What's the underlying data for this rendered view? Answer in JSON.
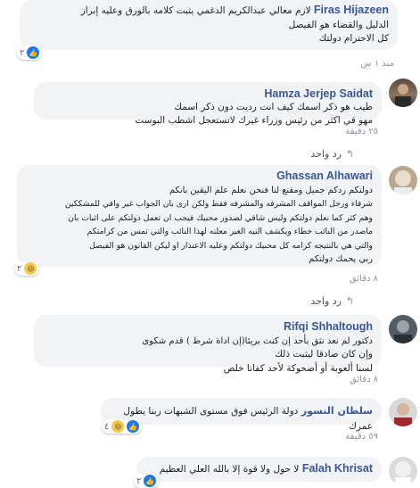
{
  "comments": [
    {
      "author": "Firas Hijazeen",
      "lines": [
        "لازم معالي عبدالكريم الدغمي يثبت كلامه بالورق وعليه إبراز",
        "الدليل والقضاء هو الفيصل",
        "كل الاحترام دولتك"
      ],
      "reaction_count": "٢",
      "time": "منذ ١ س"
    },
    {
      "author": "Hamza Jerjep Saidat",
      "lines": [
        "طيب هو ذكر اسمك كيف انت رديت دون ذكر اسمك",
        "مهو في اكثر من رئيس وزراء غيرك لاتستعجل اشطب البوست"
      ],
      "time": "٢٥ دقيقة",
      "reply_label": "رد واحد"
    },
    {
      "author": "Ghassan Alhawari",
      "lines": [
        "دولتكم ردكم جميل ومقنع لنا فنحن نعلم علم اليقين بانكم",
        "شرفاء ورجل المواقف المشرفه والمشرفه فقط ولكن ارى بان الجواب غير وافي للمشككين",
        "وهم كثر كما نعلم دولتكم وليس شافي لصدور محبيك فيجب ان تعمل دولتكم على اثبات بان",
        "ماصدر من النائب خطاء ويكشف النيه الغير معلنه لهذا النائب والتي تمس من كرامتكم",
        "والتي هي بالنتيجه كرامه كل محبيك دولتكم وعليه الاعتذار او ليكن القانون هو الفيصل",
        "ربي يحمك دولتكم"
      ],
      "reaction_count": "٢",
      "time": "٨ دقائق",
      "reply_label": "رد واحد"
    },
    {
      "author": "Rifqi Shhaltough",
      "lines": [
        "دكتور لم نعد نثق بأحد إن كنت بريئا(إن اداة شرط ) قدم شكوى",
        "وإن كان صادقا ليثبت ذلك",
        "لسنا ألعوبة أو أضحوكة لأحد كفانا خلص"
      ],
      "time": "٨ دقائق"
    },
    {
      "author": "سلطان النسور",
      "lines": [
        "دولة الرئيس فوق مستوى الشبهات ربنا يطول عمرك"
      ],
      "reaction_count": "٤",
      "time": "٥٩ دقيقة"
    },
    {
      "author": "Falah Khrisat",
      "lines": [
        "لا حول ولا قوة إلا بالله العلي العظيم"
      ],
      "reaction_count": "٢"
    }
  ],
  "colors": {
    "author": "#385898",
    "bubble": "#f2f3f5",
    "like": "#1877f2",
    "meta": "#90949c"
  },
  "icons": {
    "like": "thumbs-up-icon",
    "haha": "haha-emoji-icon",
    "reply": "reply-arrow-icon"
  }
}
